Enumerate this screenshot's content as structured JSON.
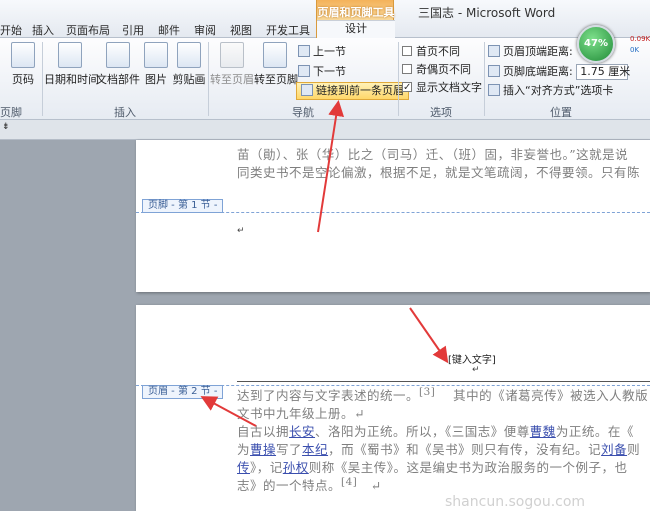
{
  "window": {
    "title": "三国志 - Microsoft Word"
  },
  "tabs": [
    "开始",
    "插入",
    "页面布局",
    "引用",
    "邮件",
    "审阅",
    "视图",
    "开发工具"
  ],
  "context_tab": {
    "group": "页眉和页脚工具",
    "tab": "设计"
  },
  "ribbon": {
    "groups": {
      "header_footer": "页脚",
      "insert": "插入",
      "navigation": "导航",
      "options": "选项",
      "position": "位置"
    },
    "buttons": {
      "page_number": "页码",
      "date_time": "日期和时间",
      "quick_parts": "文档部件",
      "picture": "图片",
      "clip_art": "剪贴画",
      "goto_header": "转至页眉",
      "goto_footer": "转至页脚",
      "previous_section": "上一节",
      "next_section": "下一节",
      "link_to_previous": "链接到前一条页眉"
    },
    "options": {
      "different_first_page": "首页不同",
      "different_odd_even": "奇偶页不同",
      "show_document_text": "显示文档文字"
    },
    "position": {
      "header_from_top_label": "页眉顶端距离:",
      "footer_from_bottom_label": "页脚底端距离:",
      "footer_from_bottom_value": "1.75 厘米",
      "insert_alignment_tab": "插入“对齐方式”选项卡"
    }
  },
  "status": {
    "zoom": "47%",
    "net_up": "0.09K",
    "net_down": "0K"
  },
  "ruler": {
    "marker": "⇟"
  },
  "document": {
    "page1_lines": [
      "苗（勛）、张（华）比之（司马）迁、（班）固，非妄誉也。”这就是说",
      "同类史书不是空论偏激，根据不足，就是文笔疏阔，不得要领。只有陈"
    ],
    "footer_tag": "页脚 - 第 1 节 -",
    "header_tag": "页眉 - 第 2 节 -",
    "header_placeholder": "[键入文字]",
    "page2": {
      "l1": "达到了内容与文字表述的统一。",
      "l1_ref": "[3]",
      "l1_tail": "其中的《诸葛亮传》被选入人教版",
      "l2": "文书中九年级上册。",
      "l3a": "自古以拥",
      "l3_changan": "长安",
      "l3b": "、洛阳为正统。所以，《三国志》便尊",
      "l3_caowei": "曹魏",
      "l3c": "为正统。在《",
      "l4a": "为",
      "l4_caocao": "曹操",
      "l4b": "写了",
      "l4_benji": "本纪",
      "l4c": "，而《蜀书》和《吴书》则只有传，没有纪。记",
      "l4_liubei": "刘备",
      "l4d": "则",
      "l5_zhuan": "传",
      "l5a": "》，记",
      "l5_sunquan": "孙权",
      "l5b": "则称《吴主传》。这是编史书为政治服务的一个例子，也",
      "l6": "志》的一个特点。",
      "l6_ref": "[4]"
    }
  },
  "watermark": "shancun.sogou.com",
  "colors": {
    "accent_orange": "#f4b25a",
    "arrow_red": "#e23a3a",
    "link_blue": "#3b4fae"
  }
}
